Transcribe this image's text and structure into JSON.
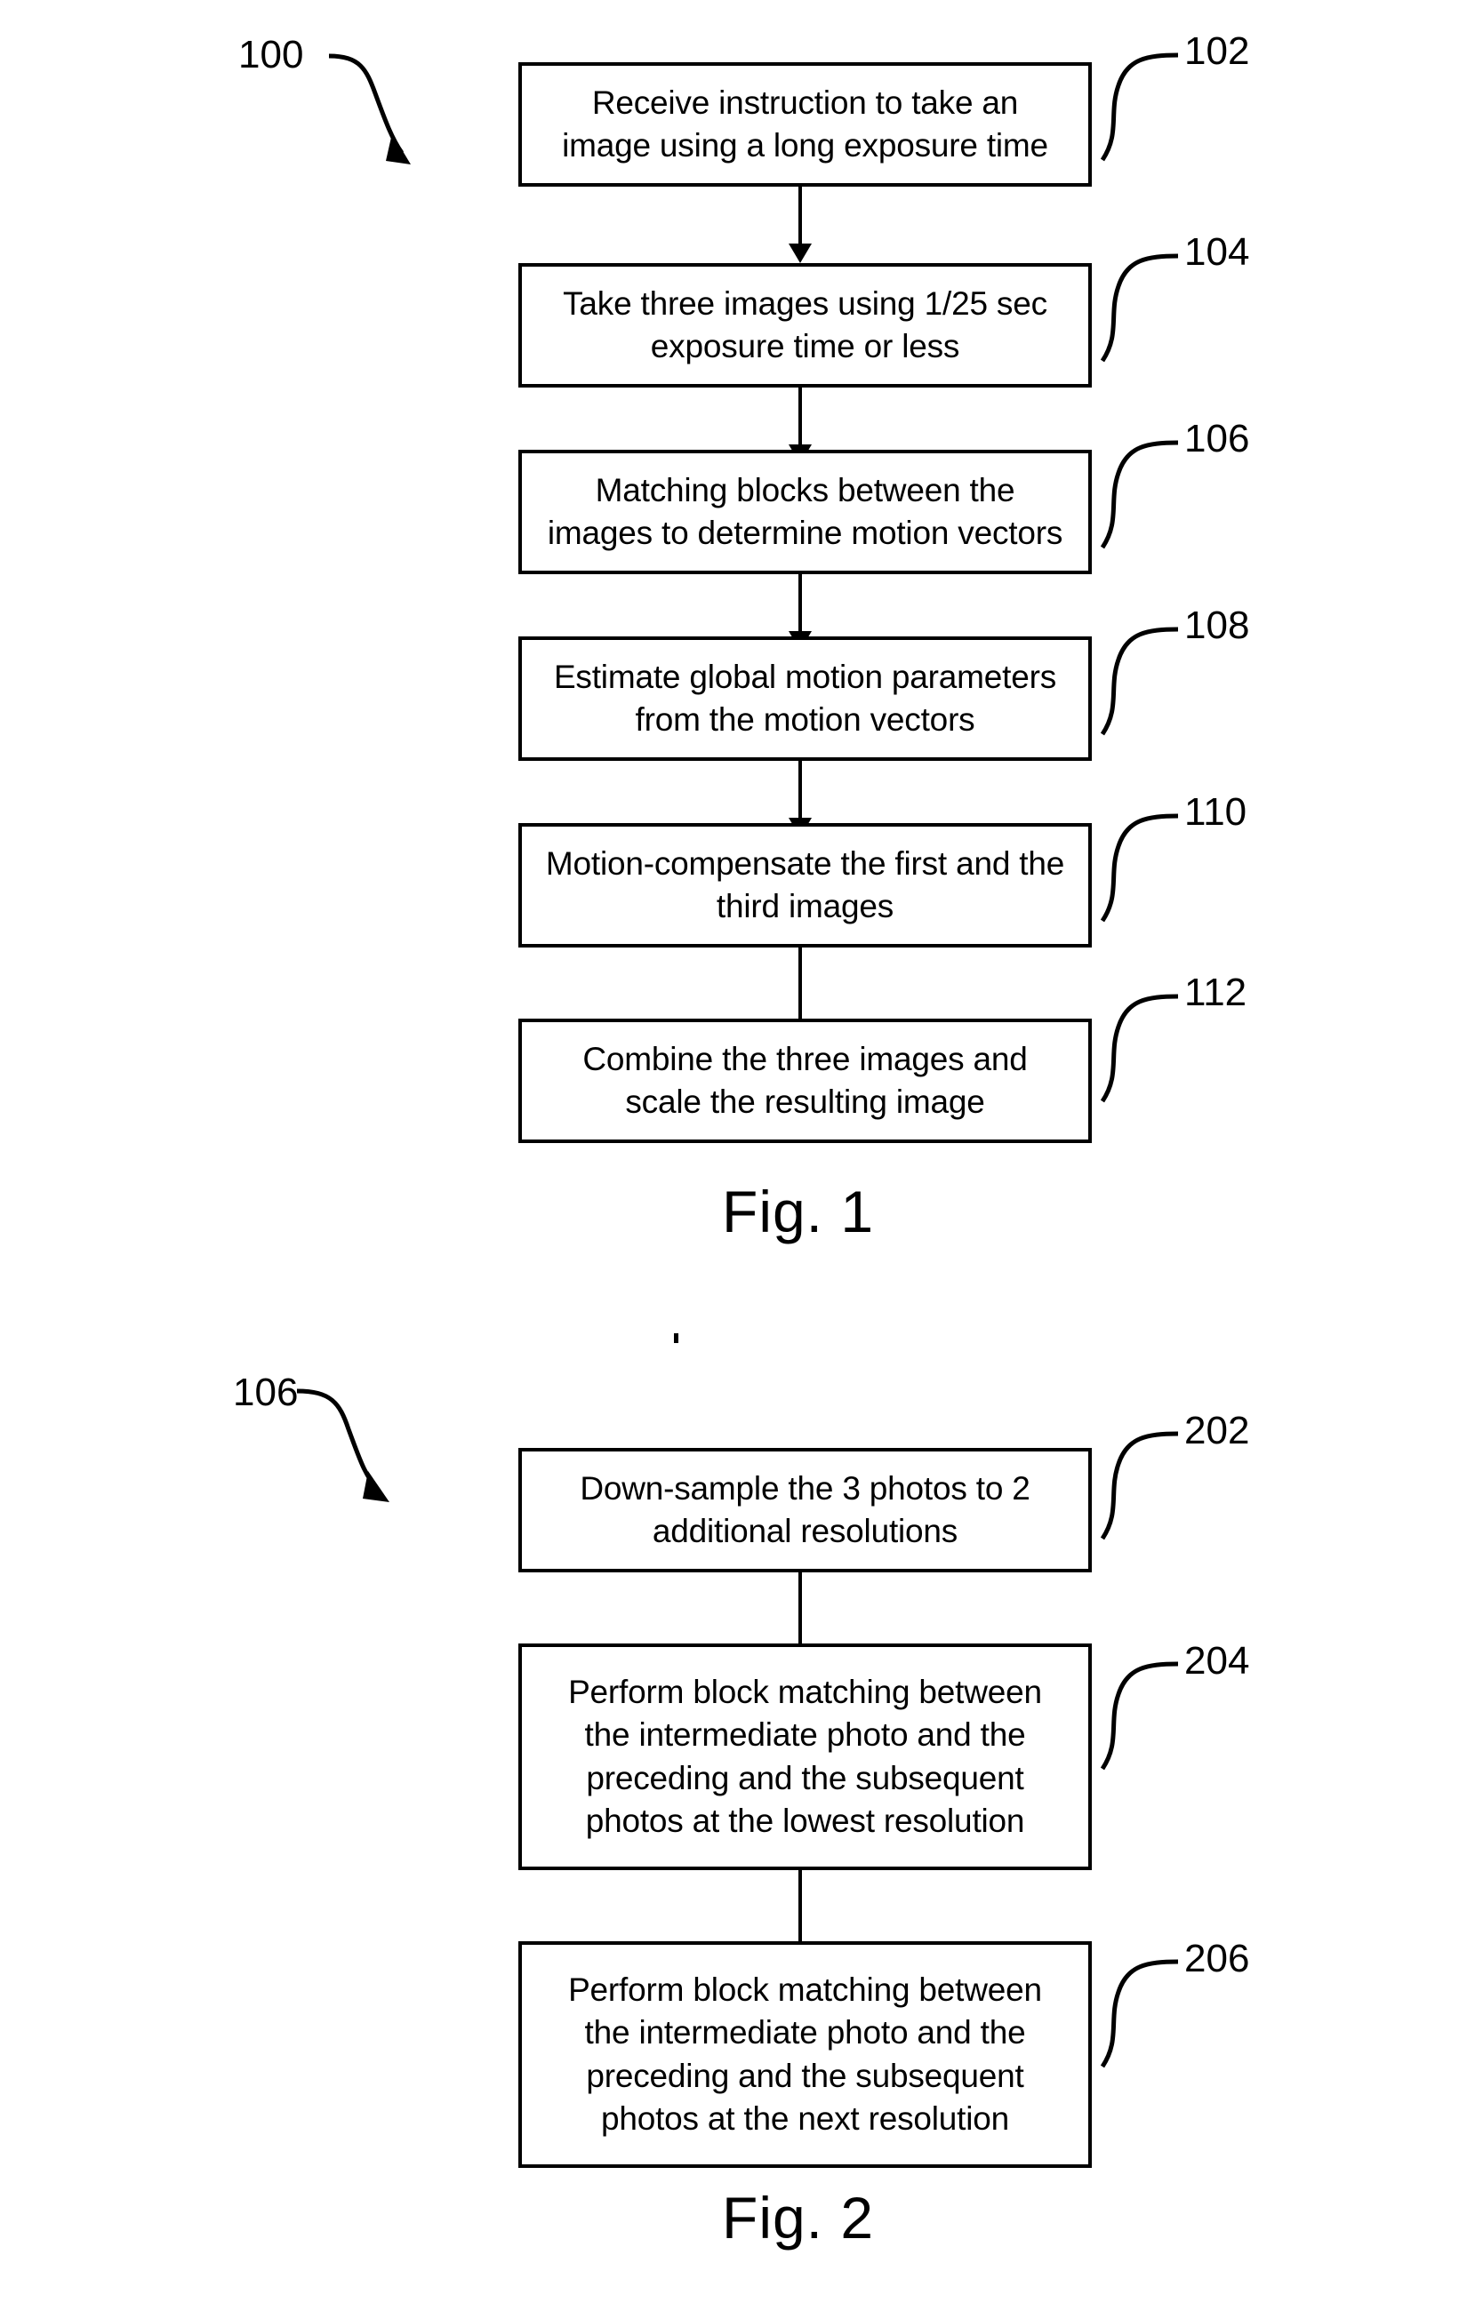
{
  "figures": [
    {
      "id": "fig-1",
      "caption": "Fig. 1",
      "diagram_ref": "100",
      "steps": [
        {
          "ref": "102",
          "lines": [
            "Receive instruction to take an",
            "image using a long exposure time"
          ]
        },
        {
          "ref": "104",
          "lines": [
            "Take three images using 1/25 sec",
            "exposure time or less"
          ]
        },
        {
          "ref": "106",
          "lines": [
            "Matching blocks between the",
            "images to determine motion vectors"
          ]
        },
        {
          "ref": "108",
          "lines": [
            "Estimate global motion parameters",
            "from the motion vectors"
          ]
        },
        {
          "ref": "110",
          "lines": [
            "Motion-compensate the first and the",
            "third images"
          ]
        },
        {
          "ref": "112",
          "lines": [
            "Combine the three images and",
            "scale the resulting image"
          ]
        }
      ]
    },
    {
      "id": "fig-2",
      "caption": "Fig. 2",
      "diagram_ref": "106",
      "steps": [
        {
          "ref": "202",
          "lines": [
            "Down-sample the 3 photos to 2",
            "additional resolutions"
          ]
        },
        {
          "ref": "204",
          "lines": [
            "Perform block matching between",
            "the intermediate photo and the",
            "preceding and the subsequent",
            "photos at the lowest resolution"
          ]
        },
        {
          "ref": "206",
          "lines": [
            "Perform block matching between",
            "the intermediate photo and the",
            "preceding and the subsequent",
            "photos at the next resolution"
          ]
        }
      ]
    }
  ],
  "colors": {
    "ink": "#000000",
    "page": "#ffffff"
  }
}
